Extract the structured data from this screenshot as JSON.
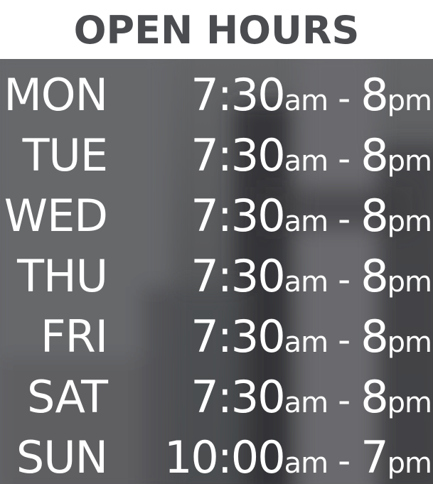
{
  "title": "OPEN HOURS",
  "schedule": [
    {
      "day": "MON",
      "open_time": "7:30",
      "open_suffix": "am",
      "separator": "-",
      "close_time": "8",
      "close_suffix": "pm"
    },
    {
      "day": "TUE",
      "open_time": "7:30",
      "open_suffix": "am",
      "separator": "-",
      "close_time": "8",
      "close_suffix": "pm"
    },
    {
      "day": "WED",
      "open_time": "7:30",
      "open_suffix": "am",
      "separator": "-",
      "close_time": "8",
      "close_suffix": "pm"
    },
    {
      "day": "THU",
      "open_time": "7:30",
      "open_suffix": "am",
      "separator": "-",
      "close_time": "8",
      "close_suffix": "pm"
    },
    {
      "day": "FRI",
      "open_time": "7:30",
      "open_suffix": "am",
      "separator": "-",
      "close_time": "8",
      "close_suffix": "pm"
    },
    {
      "day": "SAT",
      "open_time": "7:30",
      "open_suffix": "am",
      "separator": "-",
      "close_time": "8",
      "close_suffix": "pm"
    },
    {
      "day": "SUN",
      "open_time": "10:00",
      "open_suffix": "am",
      "separator": "-",
      "close_time": "7",
      "close_suffix": "pm"
    }
  ],
  "colors": {
    "title_text": "#4a4c50",
    "header_background": "#ffffff",
    "window_background": "#595a5c",
    "schedule_text": "#ffffff"
  }
}
